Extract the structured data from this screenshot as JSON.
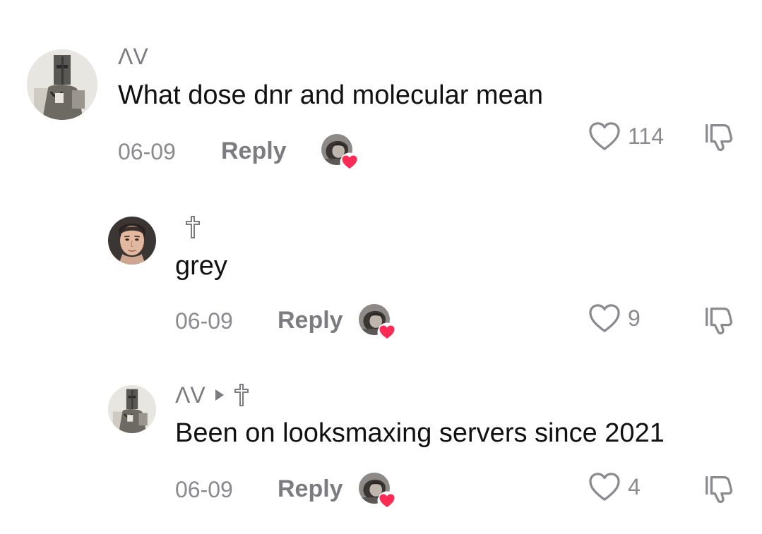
{
  "comments": [
    {
      "username": "ΛV",
      "text": "What dose dnr and molecular mean",
      "date": "06-09",
      "reply_label": "Reply",
      "likes": "114",
      "creator_liked": true
    },
    {
      "username": "",
      "text": "grey",
      "date": "06-09",
      "reply_label": "Reply",
      "likes": "9",
      "creator_liked": true
    },
    {
      "username": "ΛV",
      "reply_arrow": true,
      "text": "Been on looksmaxing servers since 2021",
      "date": "06-09",
      "reply_label": "Reply",
      "likes": "4",
      "creator_liked": true
    }
  ],
  "icons": {
    "like": "heart-outline-icon",
    "dislike": "thumbs-down-icon",
    "creator_heart": "heart-filled-icon",
    "username_cross": "cross-icon",
    "reply_arrow": "triangle-right-icon"
  },
  "colors": {
    "text_primary": "#111111",
    "text_secondary": "#8a8a8f",
    "heart_red": "#fe2c55"
  }
}
